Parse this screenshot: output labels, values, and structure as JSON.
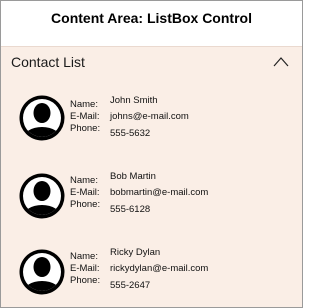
{
  "page": {
    "title": "Content Area: ListBox Control"
  },
  "listbox": {
    "header": "Contact List",
    "collapse_icon": "chevron-up-icon",
    "labels": {
      "name": "Name:",
      "email": "E-Mail:",
      "phone": "Phone:"
    },
    "contacts": [
      {
        "name": "John Smith",
        "email": "johns@e-mail.com",
        "phone": "555-5632",
        "avatar_icon": "user-silhouette-icon"
      },
      {
        "name": "Bob Martin",
        "email": "bobmartin@e-mail.com",
        "phone": "555-6128",
        "avatar_icon": "user-silhouette-icon"
      },
      {
        "name": "Ricky Dylan",
        "email": "rickydylan@e-mail.com",
        "phone": "555-2647",
        "avatar_icon": "user-silhouette-icon"
      }
    ]
  },
  "colors": {
    "panel_bg": "#faeee6",
    "avatar": "#000000"
  }
}
